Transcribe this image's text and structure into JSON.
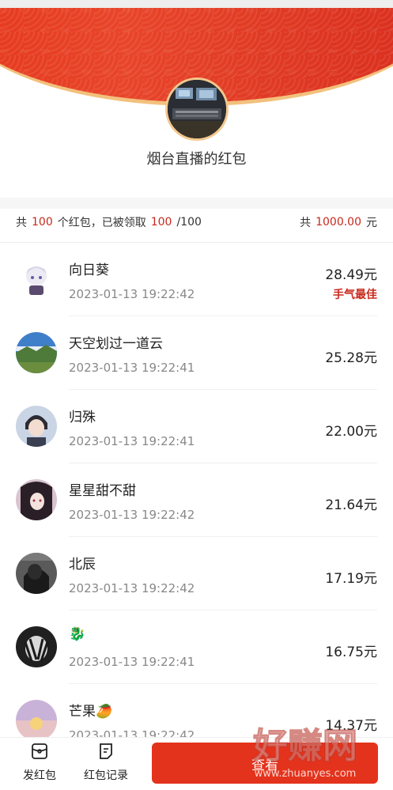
{
  "sender": {
    "title": "烟台直播的红包"
  },
  "summary": {
    "prefix": "共",
    "count": "100",
    "mid": "个红包，已被领取",
    "claimed": "100",
    "total_suffix": "/100",
    "amount_prefix": "共",
    "amount": "1000.00",
    "amount_unit": "元"
  },
  "records": [
    {
      "name": "向日葵",
      "time": "2023-01-13 19:22:42",
      "amount": "28.49元",
      "tag": "手气最佳"
    },
    {
      "name": "天空划过一道云",
      "time": "2023-01-13 19:22:41",
      "amount": "25.28元",
      "tag": ""
    },
    {
      "name": "归殊",
      "time": "2023-01-13 19:22:41",
      "amount": "22.00元",
      "tag": ""
    },
    {
      "name": "星星甜不甜",
      "time": "2023-01-13 19:22:42",
      "amount": "21.64元",
      "tag": ""
    },
    {
      "name": "北辰",
      "time": "2023-01-13 19:22:42",
      "amount": "17.19元",
      "tag": ""
    },
    {
      "name": "🐉",
      "time": "2023-01-13 19:22:41",
      "amount": "16.75元",
      "tag": ""
    },
    {
      "name": "芒果🥭",
      "time": "2023-01-13 19:22:42",
      "amount": "14.37元",
      "tag": ""
    }
  ],
  "bottom": {
    "send_label": "发红包",
    "records_label": "红包记录",
    "action_label": "查看"
  },
  "watermark": {
    "big": "好赚网",
    "small": "www.zhuanyes.com"
  },
  "colors": {
    "accent_red": "#e4331c",
    "best_red": "#c8291e",
    "banner_gold": "#f2c07a"
  }
}
